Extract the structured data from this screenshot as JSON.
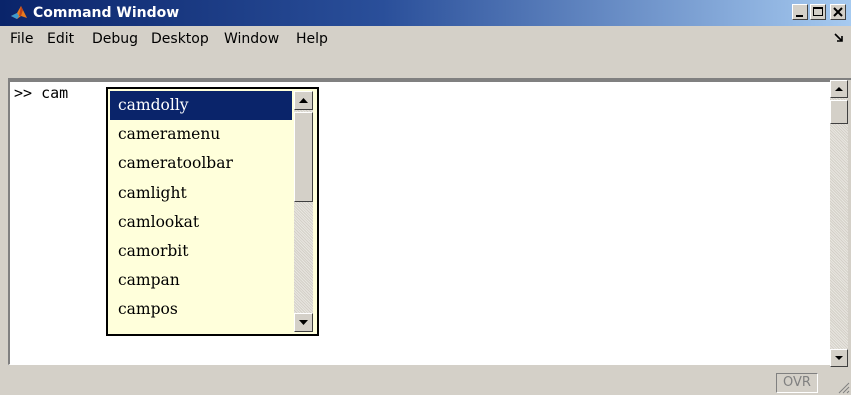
{
  "window": {
    "title": "Command Window",
    "icon": "matlab-logo-icon"
  },
  "title_buttons": {
    "minimize_icon": "minimize-icon",
    "maximize_icon": "maximize-icon",
    "close_icon": "close-icon"
  },
  "menu": {
    "items": [
      {
        "label": "File"
      },
      {
        "label": "Edit"
      },
      {
        "label": "Debug"
      },
      {
        "label": "Desktop"
      },
      {
        "label": "Window"
      },
      {
        "label": "Help"
      }
    ],
    "undock_icon": "undock-arrow-icon"
  },
  "command": {
    "prompt": ">>",
    "typed": "cam"
  },
  "completion": {
    "items": [
      {
        "label": "camdolly",
        "selected": true
      },
      {
        "label": "cameramenu",
        "selected": false
      },
      {
        "label": "cameratoolbar",
        "selected": false
      },
      {
        "label": "camlight",
        "selected": false
      },
      {
        "label": "camlookat",
        "selected": false
      },
      {
        "label": "camorbit",
        "selected": false
      },
      {
        "label": "campan",
        "selected": false
      },
      {
        "label": "campos",
        "selected": false
      }
    ]
  },
  "status": {
    "mode": "OVR"
  },
  "colors": {
    "titlebar_start": "#0a246a",
    "selection": "#0a246a",
    "popup_bg": "#ffffdb",
    "chrome": "#d4d0c8"
  }
}
